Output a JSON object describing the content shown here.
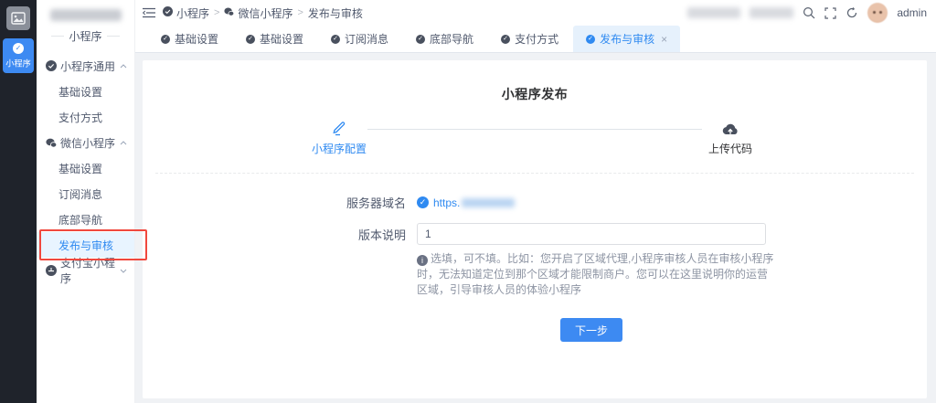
{
  "rail": {
    "app_label": "小程序"
  },
  "sidebar": {
    "section_title": "小程序",
    "items": [
      {
        "label": "小程序通用",
        "type": "group",
        "chevron": "up"
      },
      {
        "label": "基础设置",
        "type": "sub"
      },
      {
        "label": "支付方式",
        "type": "sub"
      },
      {
        "label": "微信小程序",
        "type": "group",
        "chevron": "up"
      },
      {
        "label": "基础设置",
        "type": "sub"
      },
      {
        "label": "订阅消息",
        "type": "sub"
      },
      {
        "label": "底部导航",
        "type": "sub"
      },
      {
        "label": "发布与审核",
        "type": "sub",
        "active": true,
        "annotated": true
      },
      {
        "label": "支付宝小程序",
        "type": "group",
        "chevron": "down"
      }
    ]
  },
  "header": {
    "breadcrumb": [
      {
        "label": "小程序"
      },
      {
        "label": "微信小程序"
      },
      {
        "label": "发布与审核"
      }
    ],
    "separator": ">",
    "user": "admin"
  },
  "tabs": [
    {
      "label": "基础设置"
    },
    {
      "label": "基础设置"
    },
    {
      "label": "订阅消息"
    },
    {
      "label": "底部导航"
    },
    {
      "label": "支付方式"
    },
    {
      "label": "发布与审核",
      "active": true,
      "close_glyph": "×"
    }
  ],
  "content": {
    "title": "小程序发布",
    "steps": [
      {
        "label": "小程序配置",
        "state": "active"
      },
      {
        "label": "上传代码",
        "state": "wait"
      }
    ],
    "form": {
      "server_domain_label": "服务器域名",
      "server_domain_link": "https.",
      "version_label": "版本说明",
      "version_value": "1",
      "hint": "选填，可不填。比如：您开启了区域代理,小程序审核人员在审核小程序时，无法知道定位到那个区域才能限制商户。您可以在这里说明你的运营区域，引导审核人员的体验小程序",
      "next_button": "下一步"
    }
  },
  "icons": {
    "rail-logo": "image-placeholder",
    "menu-group": "check-circle",
    "wechat": "chat-bubbles",
    "header": [
      "menu-fold",
      "search",
      "fullscreen",
      "refresh"
    ],
    "steps": [
      "pencil-edit",
      "cloud-upload"
    ],
    "form": [
      "check-circle-blue",
      "info-circle"
    ]
  },
  "colors": {
    "accent_blue": "#3d8af2",
    "link_blue": "#2f8af1",
    "active_bg": "#e8f4ff",
    "tab_active_bg": "#e6f1fc",
    "rail_bg": "#1f232b",
    "content_bg": "#f0f2f5",
    "annotation_red": "#f0483e",
    "hint_grey": "#8d94a3"
  }
}
